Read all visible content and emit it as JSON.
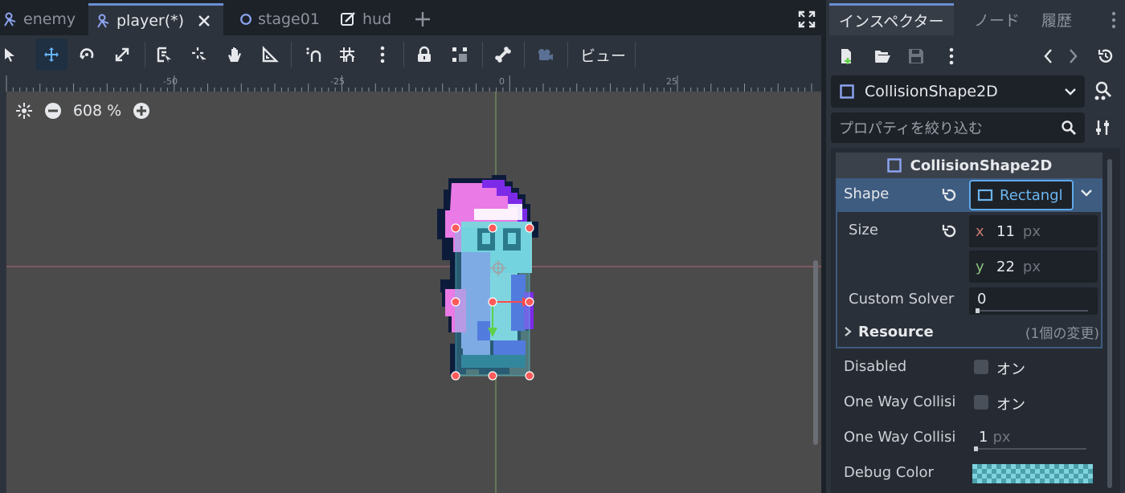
{
  "scene_tabs": [
    {
      "label": "enemy",
      "icon": "character-body-icon"
    },
    {
      "label": "player(*)",
      "icon": "character-body-icon",
      "active": true
    },
    {
      "label": "stage01",
      "icon": "node-circle-icon"
    },
    {
      "label": "hud",
      "icon": "control-icon"
    }
  ],
  "toolbar": {
    "view_label": "ビュー",
    "tools": [
      "select-tool",
      "move-tool",
      "rotate-tool",
      "scale-tool",
      "list-select-tool",
      "pivot-tool",
      "pan-tool",
      "ruler-tool",
      "smart-snap-toggle",
      "grid-snap-toggle",
      "snap-options",
      "lock-button",
      "group-button",
      "skeleton-button",
      "camera-override-button"
    ]
  },
  "ruler": {
    "labels": [
      "-50",
      "-25",
      "0",
      "25"
    ]
  },
  "viewport": {
    "zoom_label": "608 %"
  },
  "inspector": {
    "dock_tabs": [
      "インスペクター",
      "ノード",
      "履歴"
    ],
    "node_name": "CollisionShape2D",
    "filter_placeholder": "プロパティを絞り込む",
    "section_title": "CollisionShape2D",
    "shape": {
      "label": "Shape",
      "value": "Rectangl"
    },
    "size": {
      "label": "Size",
      "x_axis": "x",
      "x": "11",
      "y_axis": "y",
      "y": "22",
      "unit": "px"
    },
    "custom_solver": {
      "label": "Custom Solver",
      "value": "0"
    },
    "resource": {
      "label": "Resource",
      "changes": "(1個の変更)"
    },
    "disabled": {
      "label": "Disabled",
      "value_label": "オン"
    },
    "one_way": {
      "label": "One Way Collisi",
      "value_label": "オン"
    },
    "one_way_margin": {
      "label": "One Way Collisi",
      "value": "1",
      "unit": "px"
    },
    "debug_color": {
      "label": "Debug Color",
      "color": "#7fd3dd"
    }
  },
  "colors": {
    "accent": "#6a8fd2",
    "selected_row": "#3e5b80",
    "handle": "#ff5a5a"
  }
}
